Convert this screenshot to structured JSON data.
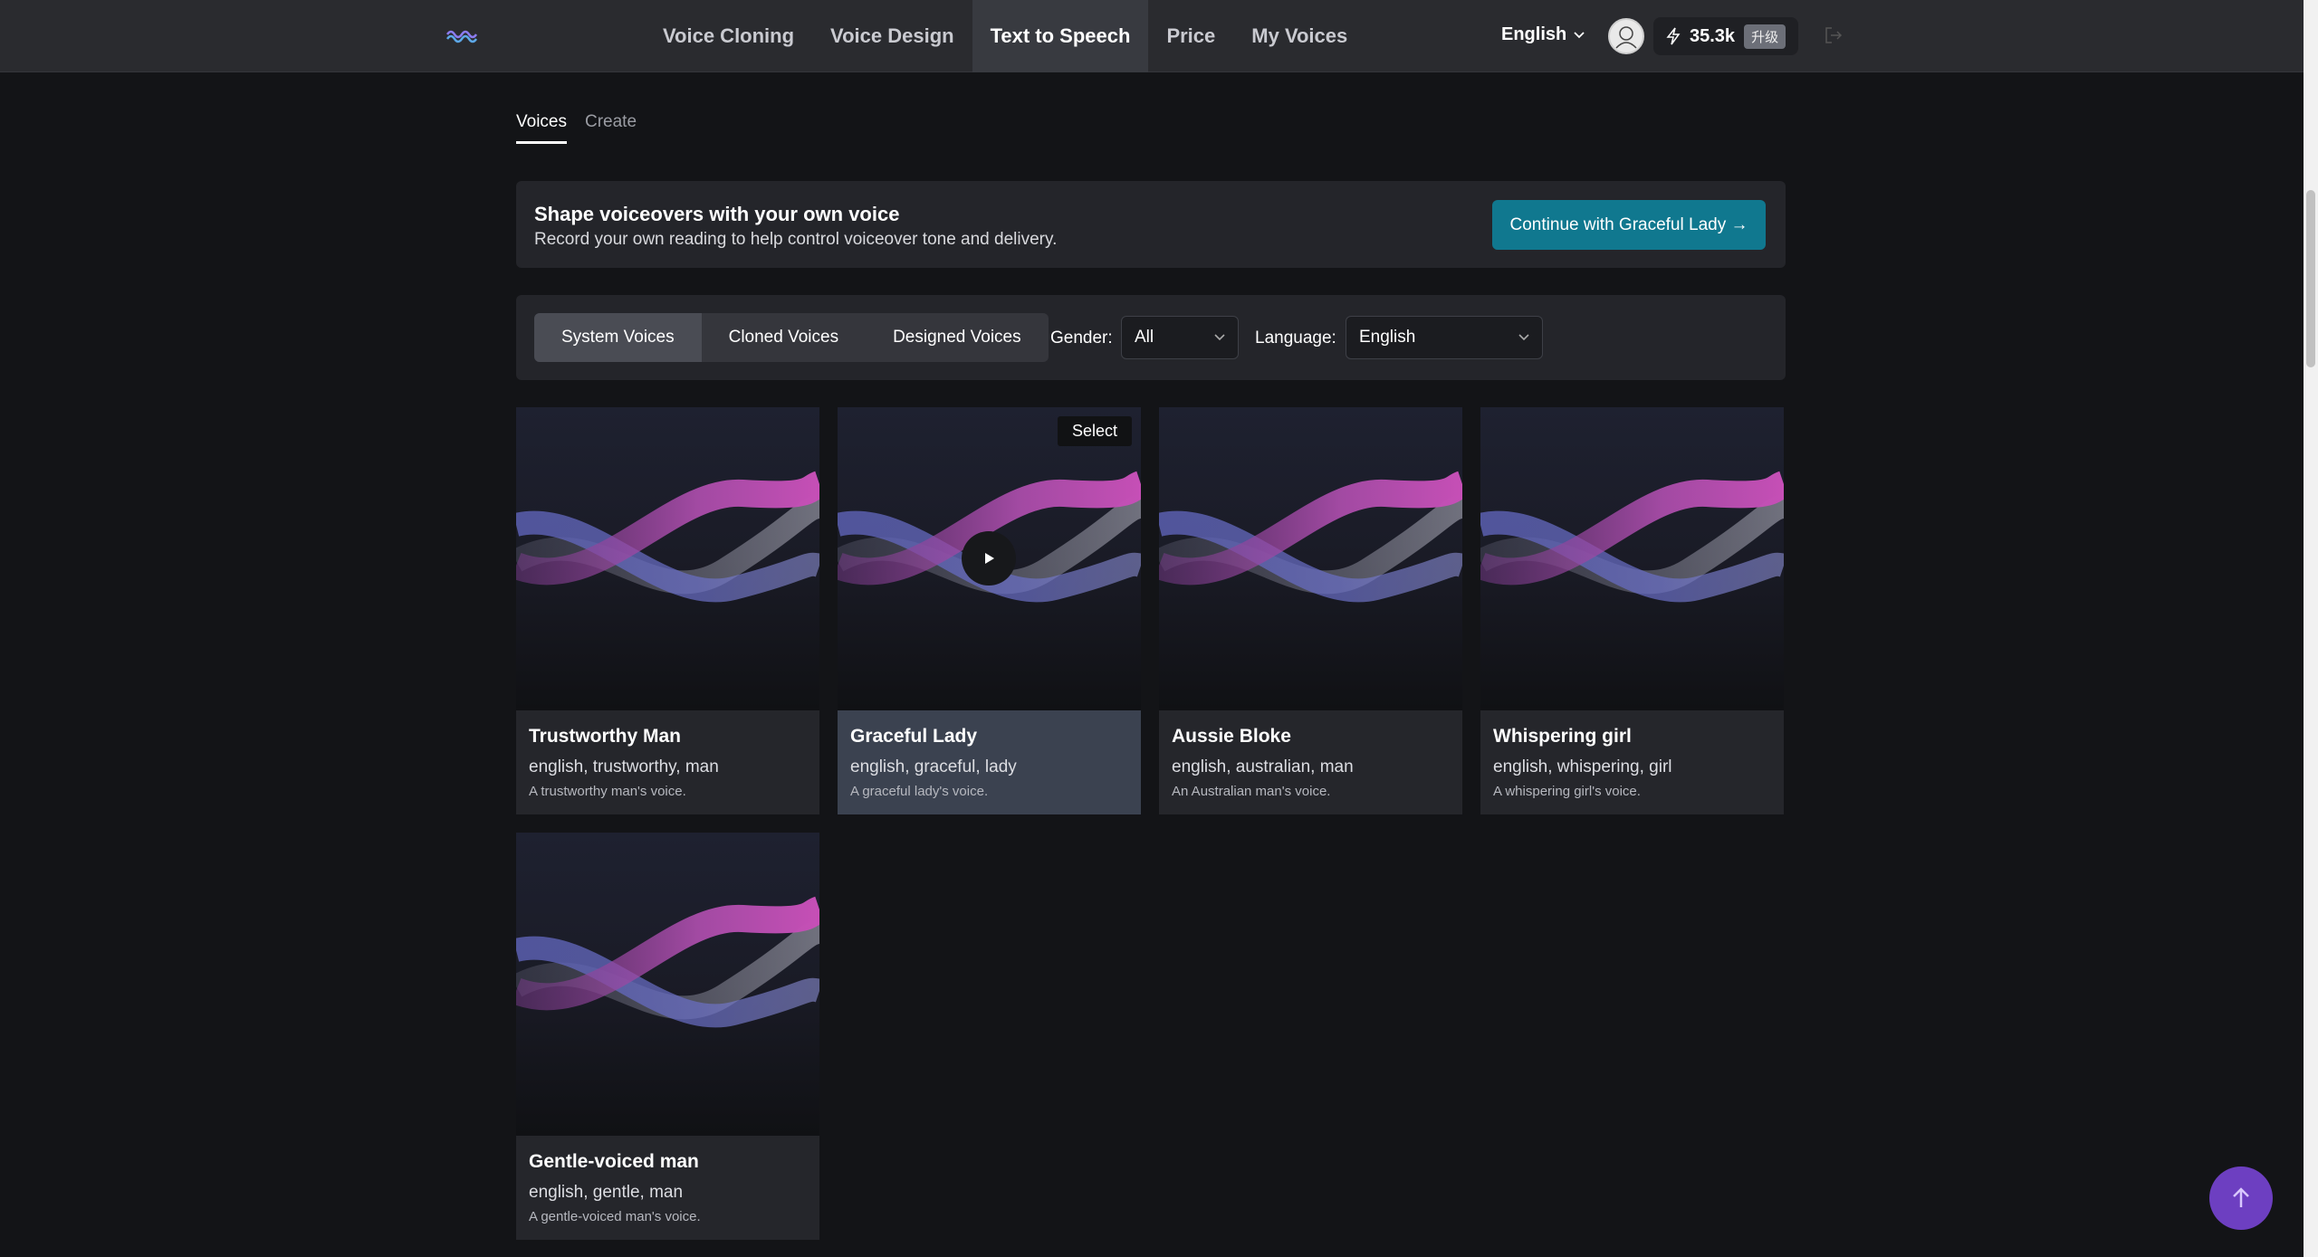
{
  "nav": {
    "items": [
      "Voice Cloning",
      "Voice Design",
      "Text to Speech",
      "Price",
      "My Voices"
    ],
    "active_index": 2,
    "language": "English",
    "credits": "35.3k",
    "upgrade_label": "升级"
  },
  "subtabs": [
    "Voices",
    "Create"
  ],
  "banner": {
    "title": "Shape voiceovers with your own voice",
    "description": "Record your own reading to help control voiceover tone and delivery.",
    "button": "Continue with Graceful Lady →"
  },
  "filters": {
    "segments": [
      "System Voices",
      "Cloned Voices",
      "Designed Voices"
    ],
    "active_segment": 0,
    "gender_label": "Gender:",
    "gender_value": "All",
    "language_label": "Language:",
    "language_value": "English"
  },
  "voices": [
    {
      "name": "Trustworthy Man",
      "tags": "english, trustworthy, man",
      "desc": "A trustworthy man's voice."
    },
    {
      "name": "Graceful Lady",
      "tags": "english, graceful, lady",
      "desc": "A graceful lady's voice.",
      "selected": true
    },
    {
      "name": "Aussie Bloke",
      "tags": "english, australian, man",
      "desc": "An Australian man's voice."
    },
    {
      "name": "Whispering girl",
      "tags": "english, whispering, girl",
      "desc": "A whispering girl's voice."
    },
    {
      "name": "Gentle-voiced man",
      "tags": "english, gentle, man",
      "desc": "A gentle-voiced man's voice."
    }
  ],
  "card_hover_label": "Select",
  "colors": {
    "accent_button": "#10788f",
    "scroll_top_button": "#6d3fc1",
    "selected_card": "#3b4250"
  }
}
